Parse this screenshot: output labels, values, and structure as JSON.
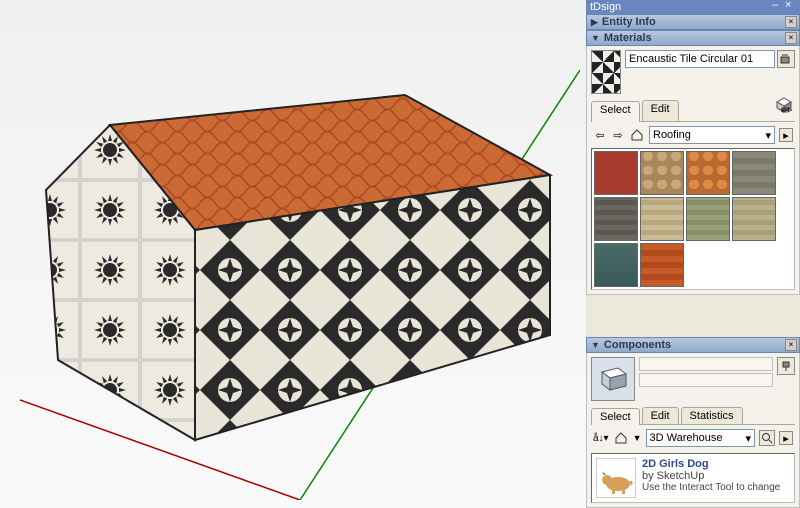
{
  "panels": {
    "entity_info": {
      "title": "Entity Info"
    },
    "materials": {
      "title": "Materials",
      "current_name": "Encaustic Tile Circular 01",
      "tabs": {
        "select": "Select",
        "edit": "Edit"
      },
      "library": "Roofing"
    },
    "components": {
      "title": "Components",
      "tabs": {
        "select": "Select",
        "edit": "Edit",
        "statistics": "Statistics"
      },
      "library": "3D Warehouse",
      "item": {
        "title": "2D Girls Dog",
        "author": "by SketchUp",
        "desc": "Use the Interact Tool to change"
      }
    }
  },
  "title_bar": "tDsign"
}
